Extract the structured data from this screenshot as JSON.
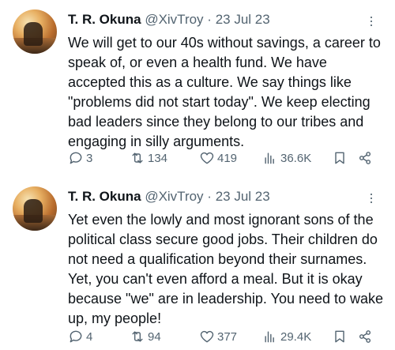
{
  "tweets": [
    {
      "author_name": "T. R. Okuna",
      "handle": "@XivTroy",
      "separator": "·",
      "date": "23 Jul 23",
      "text": "We will get to our 40s without savings, a career to speak of, or even a health fund. We have accepted this as a culture. We say things like \"problems did not start today\". We keep electing bad leaders since they belong to our tribes and engaging in silly arguments.",
      "replies": "3",
      "retweets": "134",
      "likes": "419",
      "views": "36.6K"
    },
    {
      "author_name": "T. R. Okuna",
      "handle": "@XivTroy",
      "separator": "·",
      "date": "23 Jul 23",
      "text": "Yet even the lowly and most ignorant sons of the political class secure good jobs. Their children do not need a qualification beyond their surnames. Yet, you can't even afford a meal. But it is okay because \"we\" are in leadership. You need to wake up, my people!",
      "replies": "4",
      "retweets": "94",
      "likes": "377",
      "views": "29.4K"
    }
  ],
  "colors": {
    "text": "#0f1419",
    "muted": "#536471",
    "background": "#ffffff"
  },
  "icons": [
    "more-icon",
    "reply-icon",
    "retweet-icon",
    "like-icon",
    "views-icon",
    "bookmark-icon",
    "share-icon"
  ]
}
